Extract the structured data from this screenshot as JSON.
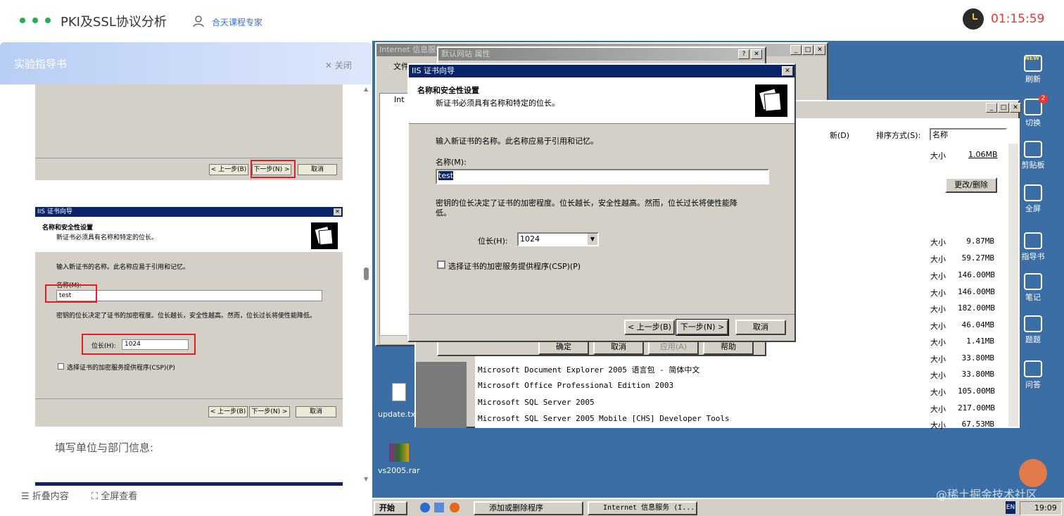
{
  "topbar": {
    "title": "PKI及SSL协议分析",
    "expert": "合天课程专家",
    "timer": "01:15:59"
  },
  "guide": {
    "title": "实验指导书",
    "close": "✕ 关闭",
    "text_fill_unit": "填写单位与部门信息:",
    "footer_collapse": "☰ 折叠内容",
    "footer_fullscreen": "⛶ 全屏查看",
    "shot1": {
      "prev": "< 上一步(B)",
      "next": "下一步(N) >",
      "cancel": "取消"
    },
    "shot2": {
      "title": "IIS 证书向导",
      "heading": "名称和安全性设置",
      "sub": "新证书必须具有名称和特定的位长。",
      "intro": "输入新证书的名称。此名称应易于引用和记忆。",
      "name_label": "名称(M):",
      "name_value": "test",
      "bits_desc": "密钥的位长决定了证书的加密程度。位长越长，安全性越高。然而，位长过长将使性能降低。",
      "bits_label": "位长(H):",
      "bits_value": "1024",
      "csp": "选择证书的加密服务提供程序(CSP)(P)",
      "prev": "< 上一步(B)",
      "next": "下一步(N) >",
      "cancel": "取消"
    }
  },
  "vm": {
    "iis_window_title": "Internet 信息服务",
    "menu_file": "文件",
    "tree_item": "Int",
    "props_title": "默认网站 属性",
    "props_buttons": {
      "ok": "确定",
      "cancel": "取消",
      "apply": "应用(A)",
      "help": "帮助"
    },
    "wizard": {
      "title": "IIS 证书向导",
      "heading": "名称和安全性设置",
      "sub": "新证书必须具有名称和特定的位长。",
      "intro": "输入新证书的名称。此名称应易于引用和记忆。",
      "name_label": "名称(M):",
      "name_value": "test",
      "bits_desc": "密钥的位长决定了证书的加密程度。位长越长，安全性越高。然而，位长过长将使性能降低。",
      "bits_label": "位长(H):",
      "bits_value": "1024",
      "csp": "选择证书的加密服务提供程序(CSP)(P)",
      "prev": "< 上一步(B)",
      "next": "下一步(N) >",
      "cancel": "取消"
    },
    "addremove": {
      "show_updates": "新(D)",
      "sort_label": "排序方式(S):",
      "sort_value": "名称",
      "change_remove": "更改/删除",
      "size_label": "大小",
      "first_size": "1.06MB",
      "sizes": [
        "9.87MB",
        "59.27MB",
        "146.00MB",
        "146.00MB",
        "182.00MB",
        "46.04MB",
        "1.41MB",
        "33.80MB",
        "33.80MB",
        "105.00MB",
        "217.00MB",
        "67.53MB"
      ],
      "programs": [
        "Microsoft Document Explorer 2005 语言包 - 简体中文",
        "Microsoft Office Professional Edition 2003",
        "Microsoft SQL Server 2005",
        "Microsoft SQL Server 2005 Mobile [CHS] Developer Tools"
      ]
    },
    "desktop": {
      "icon1": "update.tx",
      "icon2": "vs2005.rar"
    },
    "taskbar": {
      "start": "开始",
      "task1": "添加或删除程序",
      "task2": "Internet 信息服务 (I...",
      "lang": "EN",
      "clock": "19:09"
    }
  },
  "sidebar": {
    "items": [
      "刷新",
      "切换",
      "剪贴板",
      "全屏",
      "指导书",
      "笔记",
      "题题",
      "问答"
    ],
    "badge_new": "NEW",
    "badge_count": "2"
  },
  "watermark": "@稀土掘金技术社区"
}
